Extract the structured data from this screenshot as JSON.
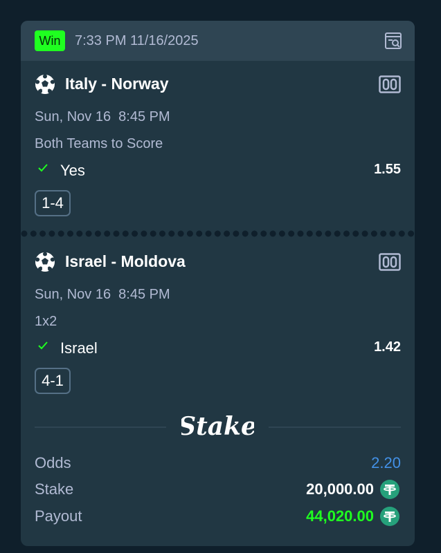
{
  "header": {
    "status_badge": "Win",
    "datetime": "7:33 PM 11/16/2025",
    "receipt_icon": "receipt-search-icon"
  },
  "legs": [
    {
      "match": "Italy - Norway",
      "date": "Sun, Nov 16  8:45 PM",
      "market": "Both Teams to Score",
      "selection": "Yes",
      "odds": "1.55",
      "score": "1-4",
      "sport_icon": "soccer-ball-icon",
      "scoreboard_icon": "scoreboard-icon"
    },
    {
      "match": "Israel - Moldova",
      "date": "Sun, Nov 16  8:45 PM",
      "market": "1x2",
      "selection": "Israel",
      "odds": "1.42",
      "score": "4-1",
      "sport_icon": "soccer-ball-icon",
      "scoreboard_icon": "scoreboard-icon"
    }
  ],
  "brand": {
    "logo_text": "Stake"
  },
  "summary": {
    "odds_label": "Odds",
    "odds_value": "2.20",
    "stake_label": "Stake",
    "stake_value": "20,000.00",
    "payout_label": "Payout",
    "payout_value": "44,020.00",
    "currency_icon": "tether-icon"
  },
  "colors": {
    "page_bg": "#0f1f2b",
    "card_bg": "#213743",
    "header_bg": "#2f4553",
    "win_green": "#1fff20",
    "odds_blue": "#4391e7",
    "tether_green": "#26a17b",
    "muted_text": "#b1bad3"
  }
}
